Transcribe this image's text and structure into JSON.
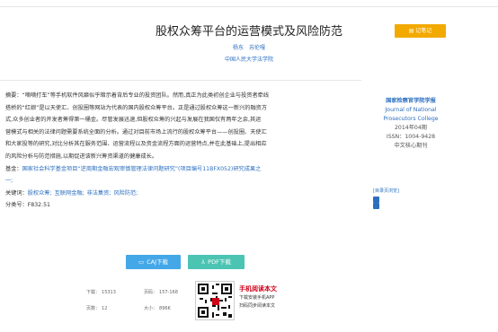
{
  "header": {
    "corner_text": ""
  },
  "article": {
    "title": "股权众筹平台的运营模式及风险防范",
    "authors": "杨东　苏伦嘎",
    "organization": "中国人民大学法学院"
  },
  "actions": {
    "note_label": "记笔记"
  },
  "toolbar": {
    "text": ""
  },
  "abstract": {
    "label": "摘要：",
    "lines": [
      "“嘀嘀打车”等手机软件风靡似乎暗示着背后专业的投资团队。然而,真正为此类初创企业与投资者牵线",
      "搭桥的“红娘”是以天使汇、创投圈等网站为代表的国内股权众筹平台。正是通过股权众筹这一新兴的融资方",
      "式,众多创业者的开发者筹得第一桶金。尽管发展迅速,但股权众筹的兴起与发展在我国仅有两年之余,其运",
      "营模式与相关的法律问题需要系统全面的分析。通过对目前市场上流行的股权众筹平台——创投圈、天使汇",
      "和大家投等的研究,对比分析其在服务范围、运营流程以及资金流程方面的运营特点,并在此基础上,提出相应",
      "的风险分析与防范措施,以期促进该新兴筹资渠道的健康成长。"
    ]
  },
  "fund": {
    "label": "基金：",
    "text": "国家社会科学基金项目“逆周期金融宏观审慎管理法律问题研究”(项目编号11BFX052)研究成果之",
    "text2": "一;"
  },
  "keywords": {
    "label": "关键词：",
    "items": [
      "股权众筹;",
      "互联网金融;",
      "非法集资;",
      "风险防范;"
    ]
  },
  "classification": {
    "label": "分类号：",
    "value": "F832.51"
  },
  "journal": {
    "name_cn": "国家检察官学院学报",
    "name_en_1": "Journal of National",
    "name_en_2": "Prosecutors College",
    "issue": "2014年04期",
    "issn": "ISSN：1004-9428",
    "core": "中文核心期刊"
  },
  "side_links": {
    "catalog": "[目录页浏览]",
    "link1": "",
    "link2": ""
  },
  "downloads": {
    "caj_label": "CAJ下载",
    "pdf_label": "PDF下载"
  },
  "stats": {
    "downloads_label": "下载：",
    "downloads_value": "15313",
    "pages_label": "页码：",
    "pages_value": "157-168",
    "pagecount_label": "页数：",
    "pagecount_value": "12",
    "size_label": "大小：",
    "size_value": "896K"
  },
  "mobile": {
    "title": "手机阅读本文",
    "line1": "下载安装手机APP",
    "line2": "扫码同步阅读本文"
  },
  "colors": {
    "link": "#2c6fbf",
    "note_button": "#f2a900",
    "caj_button": "#44a7e8",
    "pdf_button": "#4cc4b4",
    "mobile_title": "#d0021b"
  },
  "icons": {
    "caj": "book-icon",
    "pdf": "pdf-icon",
    "note": "note-icon"
  }
}
